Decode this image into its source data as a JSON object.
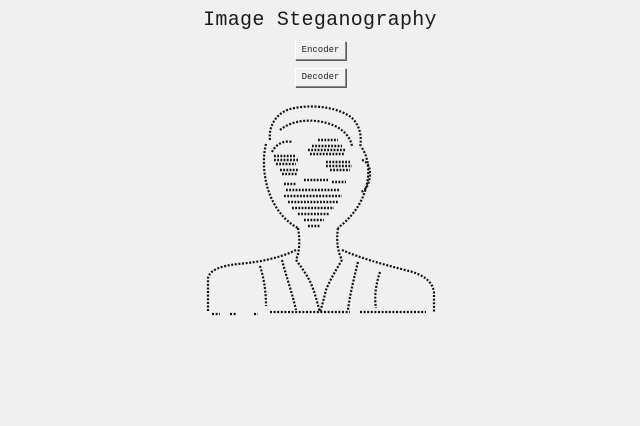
{
  "app": {
    "title": "Image Steganography"
  },
  "buttons": {
    "encoder_label": "Encoder",
    "decoder_label": "Decoder"
  },
  "preview": {
    "description_icon": "ascii-portrait-image"
  },
  "colors": {
    "background": "#f0f0f0",
    "text": "#1a1a1a",
    "art": "#111111"
  }
}
